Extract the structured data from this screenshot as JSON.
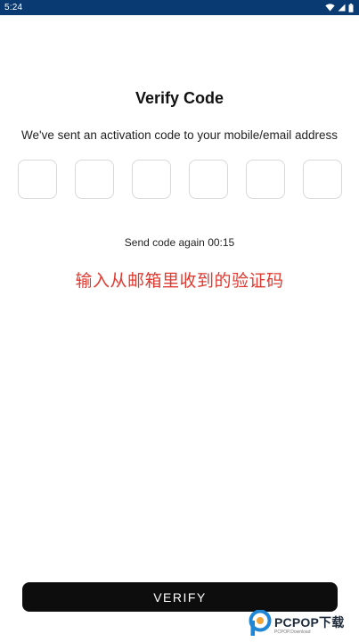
{
  "status_bar": {
    "time": "5:24",
    "icons": [
      "wifi-icon",
      "cellular-signal-icon",
      "battery-icon"
    ],
    "background": "#0a3a72"
  },
  "header": {
    "title": "Verify Code",
    "subtitle": "We've sent an activation code to your mobile/email address"
  },
  "code_inputs": {
    "count": 6,
    "values": [
      "",
      "",
      "",
      "",
      "",
      ""
    ]
  },
  "resend": {
    "label": "Send code again",
    "timer": "00:15"
  },
  "hint": {
    "text": "输入从邮箱里收到的验证码",
    "color": "#e03a30"
  },
  "actions": {
    "verify_label": "VERIFY",
    "button_color": "#0d0d0d"
  },
  "watermark": {
    "text": "PCPOP下载",
    "sub": "PCPOP.Download"
  }
}
